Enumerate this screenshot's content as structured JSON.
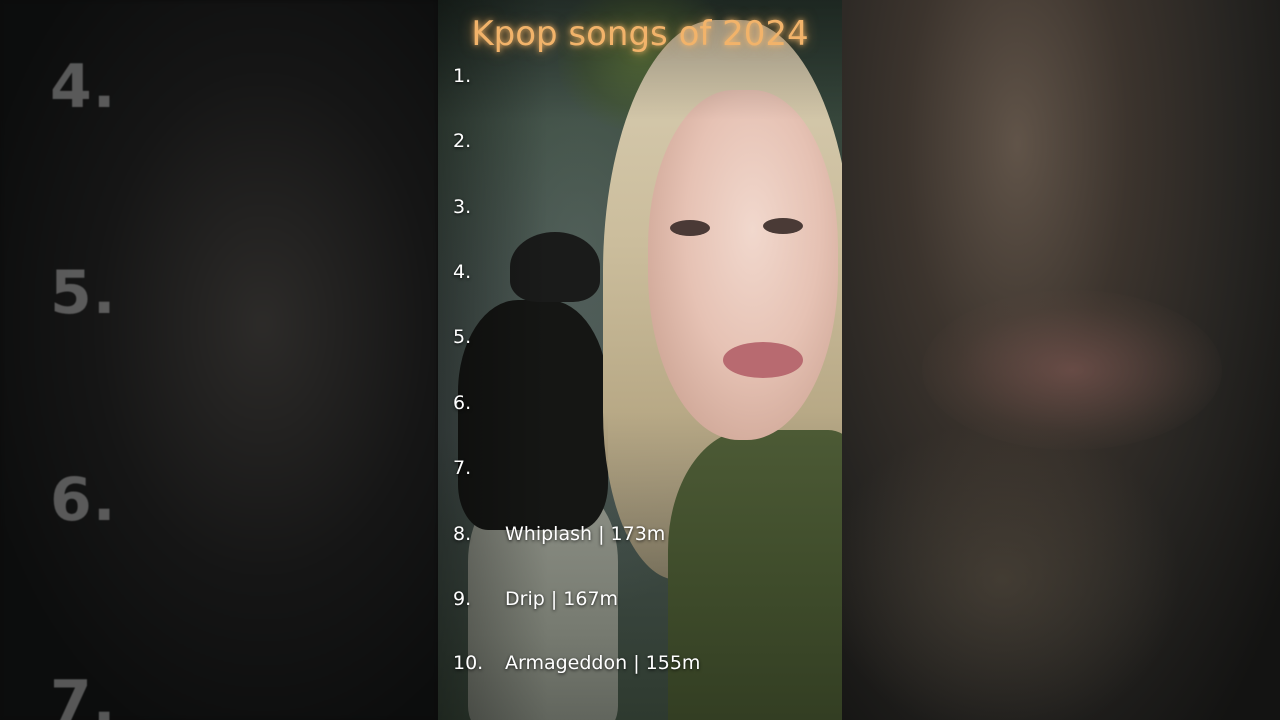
{
  "title": "Kpop songs of 2024",
  "ranking": [
    {
      "rank": "1.",
      "entry": ""
    },
    {
      "rank": "2.",
      "entry": ""
    },
    {
      "rank": "3.",
      "entry": ""
    },
    {
      "rank": "4.",
      "entry": ""
    },
    {
      "rank": "5.",
      "entry": ""
    },
    {
      "rank": "6.",
      "entry": ""
    },
    {
      "rank": "7.",
      "entry": ""
    },
    {
      "rank": "8.",
      "entry": "Whiplash | 173m"
    },
    {
      "rank": "9.",
      "entry": "Drip | 167m"
    },
    {
      "rank": "10.",
      "entry": "Armageddon | 155m"
    }
  ],
  "side_numbers": [
    "4.",
    "5.",
    "6.",
    "7."
  ],
  "colors": {
    "title": "#f2b36a",
    "text": "#ffffff",
    "side_number": "#969696"
  }
}
